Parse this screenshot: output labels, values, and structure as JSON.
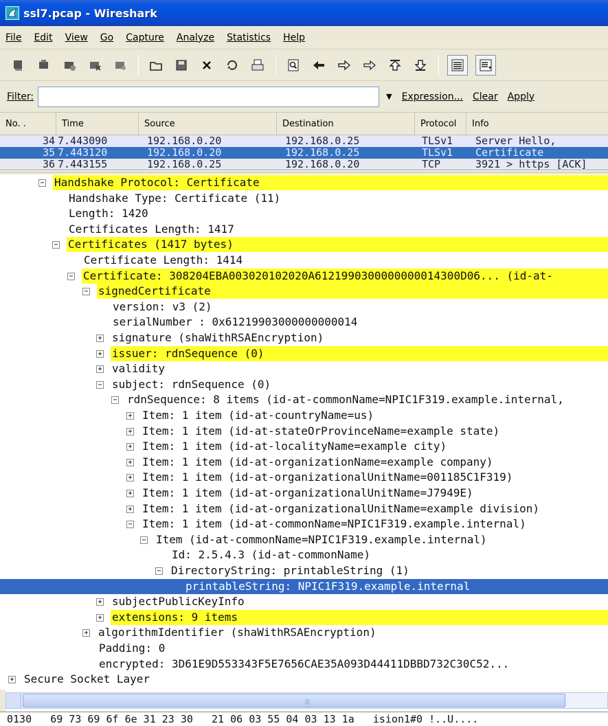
{
  "window": {
    "title": "ssl7.pcap - Wireshark"
  },
  "menu": [
    "File",
    "Edit",
    "View",
    "Go",
    "Capture",
    "Analyze",
    "Statistics",
    "Help"
  ],
  "filter": {
    "label": "Filter:",
    "value": "",
    "expression_label": "Expression...",
    "clear_label": "Clear",
    "apply_label": "Apply"
  },
  "packet_list": {
    "columns": [
      "No. .",
      "Time",
      "Source",
      "Destination",
      "Protocol",
      "Info"
    ],
    "rows": [
      {
        "no": "34",
        "time": "7.443090",
        "source": "192.168.0.20",
        "destination": "192.168.0.25",
        "protocol": "TLSv1",
        "info": "Server Hello,"
      },
      {
        "no": "35",
        "time": "7.443120",
        "source": "192.168.0.20",
        "destination": "192.168.0.25",
        "protocol": "TLSv1",
        "info": "Certificate"
      },
      {
        "no": "36",
        "time": "7.443155",
        "source": "192.168.0.25",
        "destination": "192.168.0.20",
        "protocol": "TCP",
        "info": "3921 > https [ACK]"
      }
    ]
  },
  "tree": [
    {
      "text": "Handshake Protocol: Certificate",
      "toggle": "minus",
      "hl": true
    },
    {
      "text": "Handshake Type: Certificate (11)"
    },
    {
      "text": "Length: 1420"
    },
    {
      "text": "Certificates Length: 1417"
    },
    {
      "text": "Certificates (1417 bytes)",
      "toggle": "minus",
      "hl": true
    },
    {
      "text": "Certificate Length: 1414"
    },
    {
      "text": "Certificate: 308204EBA003020102020A6121990300000000014300D06... (id-at-",
      "toggle": "minus",
      "hl": true
    },
    {
      "text": "signedCertificate",
      "toggle": "minus",
      "hl": true
    },
    {
      "text": "version: v3 (2)"
    },
    {
      "text": "serialNumber : 0x61219903000000000014"
    },
    {
      "text": "signature (shaWithRSAEncryption)",
      "toggle": "plus"
    },
    {
      "text": "issuer: rdnSequence (0)",
      "toggle": "plus",
      "hl": true
    },
    {
      "text": "validity",
      "toggle": "plus"
    },
    {
      "text": "subject: rdnSequence (0)",
      "toggle": "minus"
    },
    {
      "text": "rdnSequence: 8 items (id-at-commonName=NPIC1F319.example.internal,",
      "toggle": "minus"
    },
    {
      "text": "Item: 1 item (id-at-countryName=us)",
      "toggle": "plus"
    },
    {
      "text": "Item: 1 item (id-at-stateOrProvinceName=example state)",
      "toggle": "plus"
    },
    {
      "text": "Item: 1 item (id-at-localityName=example city)",
      "toggle": "plus"
    },
    {
      "text": "Item: 1 item (id-at-organizationName=example company)",
      "toggle": "plus"
    },
    {
      "text": "Item: 1 item (id-at-organizationalUnitName=001185C1F319)",
      "toggle": "plus"
    },
    {
      "text": "Item: 1 item (id-at-organizationalUnitName=J7949E)",
      "toggle": "plus"
    },
    {
      "text": "Item: 1 item (id-at-organizationalUnitName=example division)",
      "toggle": "plus"
    },
    {
      "text": "Item: 1 item (id-at-commonName=NPIC1F319.example.internal)",
      "toggle": "minus"
    },
    {
      "text": "Item (id-at-commonName=NPIC1F319.example.internal)",
      "toggle": "minus"
    },
    {
      "text": "Id: 2.5.4.3 (id-at-commonName)"
    },
    {
      "text": "DirectoryString: printableString (1)",
      "toggle": "minus"
    },
    {
      "text": "printableString: NPIC1F319.example.internal",
      "selected": true
    },
    {
      "text": "subjectPublicKeyInfo",
      "toggle": "plus"
    },
    {
      "text": "extensions: 9 items",
      "toggle": "plus",
      "hl": true
    },
    {
      "text": "algorithmIdentifier (shaWithRSAEncryption)",
      "toggle": "plus"
    },
    {
      "text": "Padding: 0"
    },
    {
      "text": "encrypted: 3D61E9D553343F5E7656CAE35A093D44411DBBD732C30C52..."
    },
    {
      "text": "Secure Socket Layer",
      "toggle": "plus"
    }
  ],
  "hex": {
    "line": "0130   69 73 69 6f 6e 31 23 30   21 06 03 55 04 03 13 1a   ision1#0 !..U...."
  },
  "icons": {
    "title": "wireshark-fin-icon",
    "toolbar": [
      "interfaces-icon",
      "options-icon",
      "start-icon",
      "stop-icon",
      "restart-icon",
      "open-icon",
      "save-icon",
      "close-icon",
      "reload-icon",
      "print-icon",
      "find-icon",
      "back-icon",
      "forward-icon",
      "goto-icon",
      "first-icon",
      "last-icon",
      "colorize-icon",
      "autoscroll-icon"
    ]
  }
}
